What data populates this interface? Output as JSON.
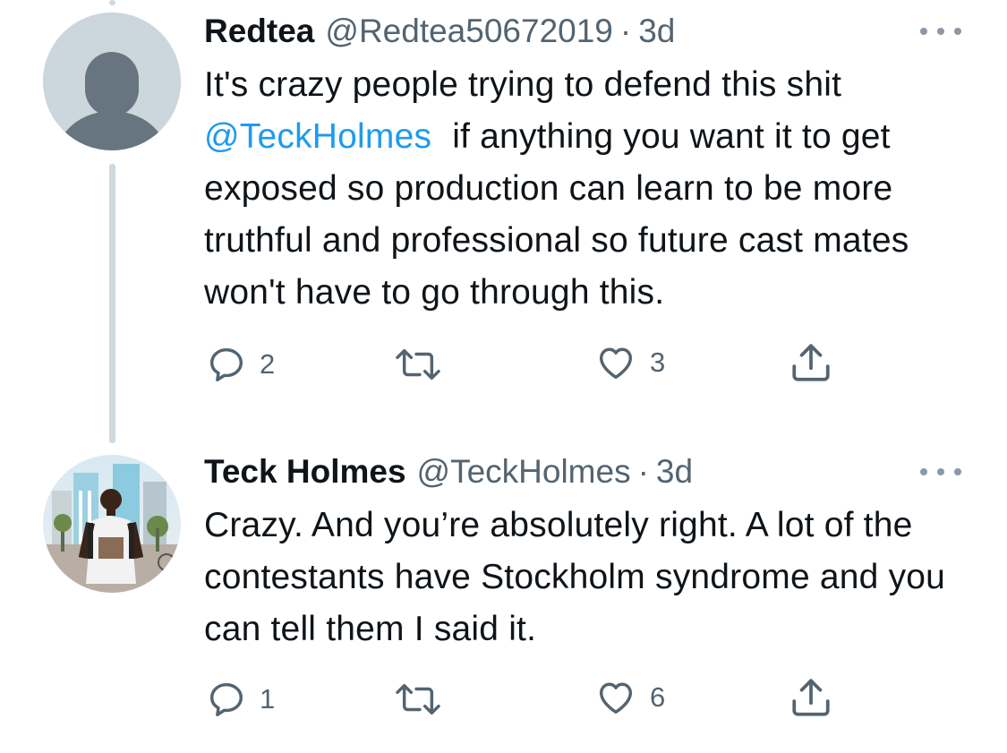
{
  "tweets": [
    {
      "name": "Redtea",
      "handle": "@Redtea50672019",
      "separator": "·",
      "time": "3d",
      "text_line1": "It's crazy people trying to defend this shit",
      "mention": "@TeckHolmes",
      "text_after_mention": "if anything you want it to get exposed so production can learn to be more truthful and professional so future cast mates won't have to go through this.",
      "reply_count": "2",
      "retweet_count": "",
      "like_count": "3",
      "avatar": "default-avatar"
    },
    {
      "name": "Teck Holmes",
      "handle": "@TeckHolmes",
      "separator": "·",
      "time": "3d",
      "text": "Crazy. And you’re absolutely right. A lot of the contestants have Stockholm syndrome and you can tell them I said it.",
      "reply_count": "1",
      "retweet_count": "",
      "like_count": "6",
      "avatar": "photo-avatar"
    }
  ],
  "icons": {
    "reply": "reply-icon",
    "retweet": "retweet-icon",
    "like": "heart-icon",
    "share": "share-icon",
    "more": "more-icon"
  },
  "colors": {
    "text": "#0f1419",
    "secondary": "#536471",
    "link": "#1d9bf0",
    "thread_line": "#cfd9de"
  }
}
